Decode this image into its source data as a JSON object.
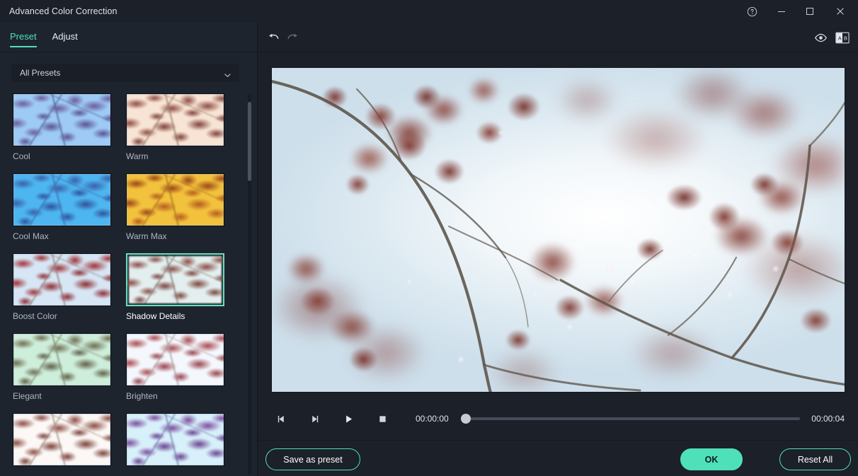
{
  "window": {
    "title": "Advanced Color Correction",
    "controls": [
      {
        "name": "help",
        "glyph": "?"
      },
      {
        "name": "minimize",
        "glyph": "—"
      },
      {
        "name": "maximize",
        "glyph": "□"
      },
      {
        "name": "close",
        "glyph": "✕"
      }
    ]
  },
  "left_panel": {
    "tabs": [
      {
        "label": "Preset",
        "active": true
      },
      {
        "label": "Adjust",
        "active": false
      }
    ],
    "filter": {
      "selected": "All Presets",
      "options": [
        "All Presets"
      ]
    },
    "presets": [
      {
        "label": "Cool",
        "selected": false,
        "sky": "#9ecbf5",
        "leaf": "#6a5a9e",
        "leaf2": "#5b4f92",
        "branch": "#4a5f92"
      },
      {
        "label": "Warm",
        "selected": false,
        "sky": "#f7e4d4",
        "leaf": "#8d4a42",
        "leaf2": "#7d3f38",
        "branch": "#9a7a63"
      },
      {
        "label": "Cool Max",
        "selected": false,
        "sky": "#4db5f0",
        "leaf": "#3a5ea8",
        "leaf2": "#2f4f99",
        "branch": "#3f6aa8"
      },
      {
        "label": "Warm Max",
        "selected": false,
        "sky": "#f3c23c",
        "leaf": "#9a4418",
        "leaf2": "#b35a1e",
        "branch": "#a3701f"
      },
      {
        "label": "Boost Color",
        "selected": false,
        "sky": "#d6e6f5",
        "leaf": "#a02f33",
        "leaf2": "#8c2a2f",
        "branch": "#8d7f77"
      },
      {
        "label": "Shadow Details",
        "selected": true,
        "sky": "#e2efee",
        "leaf": "#8b4a44",
        "leaf2": "#7a413c",
        "branch": "#7d776c"
      },
      {
        "label": "Elegant",
        "selected": false,
        "sky": "#cdeeda",
        "leaf": "#6f6b50",
        "leaf2": "#5f5d46",
        "branch": "#7b8a6d"
      },
      {
        "label": "Brighten",
        "selected": false,
        "sky": "#f4f8fd",
        "leaf": "#a8484f",
        "leaf2": "#97414a",
        "branch": "#a79fa0"
      },
      {
        "label": "",
        "selected": false,
        "sky": "#fbf8f6",
        "leaf": "#8d4a40",
        "leaf2": "#7a3e36",
        "branch": "#9f8d82"
      },
      {
        "label": "",
        "selected": false,
        "sky": "#d7f0fa",
        "leaf": "#7b4a9e",
        "leaf2": "#6a3f90",
        "branch": "#6b7fae"
      }
    ]
  },
  "toolbar": {
    "undo": "undo-icon",
    "redo": "redo-icon",
    "preview_eye": "eye-icon",
    "compare": "ab-compare-icon"
  },
  "player": {
    "prev_frame": "previous-frame-icon",
    "next_frame": "next-frame-icon",
    "play": "play-icon",
    "stop": "stop-icon",
    "current_time": "00:00:00",
    "total_time": "00:00:04",
    "progress_percent": 0
  },
  "footer": {
    "save_label": "Save as preset",
    "ok_label": "OK",
    "reset_label": "Reset All"
  },
  "colors": {
    "accent": "#4ee0b8",
    "window_bg": "#1b2029",
    "panel_bg": "#1e242e",
    "text": "#e6e9ef"
  }
}
